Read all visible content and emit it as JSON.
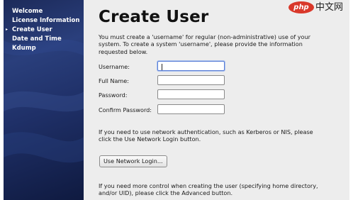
{
  "sidebar": {
    "items": [
      {
        "label": "Welcome",
        "active": false
      },
      {
        "label": "License Information",
        "active": false
      },
      {
        "label": "Create User",
        "active": true
      },
      {
        "label": "Date and Time",
        "active": false
      },
      {
        "label": "Kdump",
        "active": false
      }
    ],
    "active_marker": "▸"
  },
  "main": {
    "title": "Create User",
    "intro": "You must create a 'username' for regular (non-administrative) use of your system.  To create a system 'username', please provide the information requested below.",
    "fields": [
      {
        "label": "Username:",
        "value": "",
        "focused": true
      },
      {
        "label": "Full Name:",
        "value": "",
        "focused": false
      },
      {
        "label": "Password:",
        "value": "",
        "focused": false
      },
      {
        "label": "Confirm Password:",
        "value": "",
        "focused": false
      }
    ],
    "network_text": "If you need to use network authentication, such as Kerberos or NIS, please click the Use Network Login button.",
    "network_button": "Use Network Login...",
    "advanced_text": "If you need more control when creating the user (specifying home directory, and/or UID), please click the Advanced button."
  },
  "watermark": {
    "logo_text": "php",
    "site_text": "中文网"
  },
  "colors": {
    "sidebar_dark": "#0f1a40",
    "sidebar_mid": "#2a3f7c",
    "content_bg": "#ededed",
    "focus_border": "#5b7fd6",
    "watermark_red": "#d9382a"
  }
}
